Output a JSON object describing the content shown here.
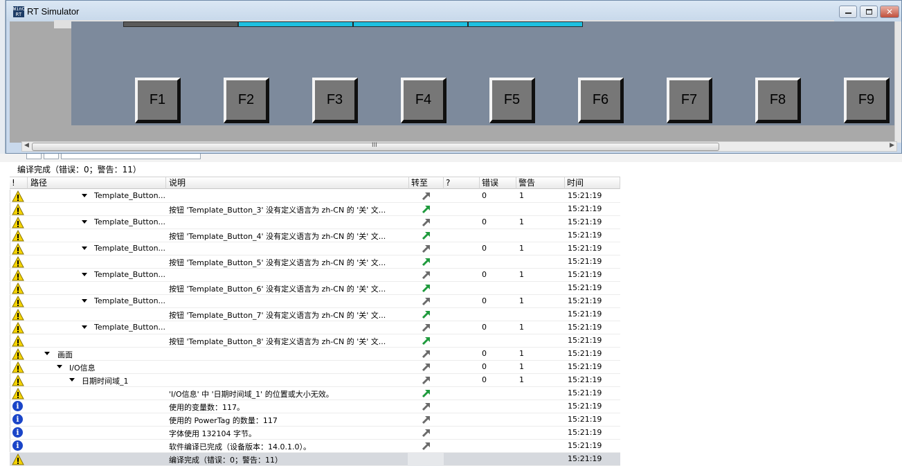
{
  "simulator": {
    "title": "RT Simulator",
    "logo_text": "WinCC RT",
    "top_bar_colors": [
      "#5a5a5a",
      "#1ec0e0",
      "#1ec0e0",
      "#1ec0e0"
    ],
    "function_keys": [
      "F1",
      "F2",
      "F3",
      "F4",
      "F5",
      "F6",
      "F7",
      "F8",
      "F9"
    ],
    "hscroll_grip": "III"
  },
  "output": {
    "summary": "编译完成（错误：0；警告：11）",
    "columns": {
      "flag": "!",
      "path": "路径",
      "description": "说明",
      "goto": "转至",
      "question": "?",
      "errors": "错误",
      "warnings": "警告",
      "time": "时间"
    },
    "rows": [
      {
        "icon": "warning",
        "indent": 1,
        "expand": true,
        "path": "Template_Button...",
        "desc": "",
        "goto": "grey",
        "errors": "0",
        "warnings": "1",
        "time": "15:21:19"
      },
      {
        "icon": "warning",
        "indent": 0,
        "expand": false,
        "path": "",
        "desc": "按钮 'Template_Button_3' 没有定义语言为 zh-CN 的 '关' 文...",
        "goto": "green",
        "errors": "",
        "warnings": "",
        "time": "15:21:19"
      },
      {
        "icon": "warning",
        "indent": 1,
        "expand": true,
        "path": "Template_Button...",
        "desc": "",
        "goto": "grey",
        "errors": "0",
        "warnings": "1",
        "time": "15:21:19"
      },
      {
        "icon": "warning",
        "indent": 0,
        "expand": false,
        "path": "",
        "desc": "按钮 'Template_Button_4' 没有定义语言为 zh-CN 的 '关' 文...",
        "goto": "green",
        "errors": "",
        "warnings": "",
        "time": "15:21:19"
      },
      {
        "icon": "warning",
        "indent": 1,
        "expand": true,
        "path": "Template_Button...",
        "desc": "",
        "goto": "grey",
        "errors": "0",
        "warnings": "1",
        "time": "15:21:19"
      },
      {
        "icon": "warning",
        "indent": 0,
        "expand": false,
        "path": "",
        "desc": "按钮 'Template_Button_5' 没有定义语言为 zh-CN 的 '关' 文...",
        "goto": "green",
        "errors": "",
        "warnings": "",
        "time": "15:21:19"
      },
      {
        "icon": "warning",
        "indent": 1,
        "expand": true,
        "path": "Template_Button...",
        "desc": "",
        "goto": "grey",
        "errors": "0",
        "warnings": "1",
        "time": "15:21:19"
      },
      {
        "icon": "warning",
        "indent": 0,
        "expand": false,
        "path": "",
        "desc": "按钮 'Template_Button_6' 没有定义语言为 zh-CN 的 '关' 文...",
        "goto": "green",
        "errors": "",
        "warnings": "",
        "time": "15:21:19"
      },
      {
        "icon": "warning",
        "indent": 1,
        "expand": true,
        "path": "Template_Button...",
        "desc": "",
        "goto": "grey",
        "errors": "0",
        "warnings": "1",
        "time": "15:21:19"
      },
      {
        "icon": "warning",
        "indent": 0,
        "expand": false,
        "path": "",
        "desc": "按钮 'Template_Button_7' 没有定义语言为 zh-CN 的 '关' 文...",
        "goto": "green",
        "errors": "",
        "warnings": "",
        "time": "15:21:19"
      },
      {
        "icon": "warning",
        "indent": 1,
        "expand": true,
        "path": "Template_Button...",
        "desc": "",
        "goto": "grey",
        "errors": "0",
        "warnings": "1",
        "time": "15:21:19"
      },
      {
        "icon": "warning",
        "indent": 0,
        "expand": false,
        "path": "",
        "desc": "按钮 'Template_Button_8' 没有定义语言为 zh-CN 的 '关' 文...",
        "goto": "green",
        "errors": "",
        "warnings": "",
        "time": "15:21:19"
      },
      {
        "icon": "warning",
        "indent": 2,
        "expand": true,
        "path": "画面",
        "desc": "",
        "goto": "grey",
        "errors": "0",
        "warnings": "1",
        "time": "15:21:19"
      },
      {
        "icon": "warning",
        "indent": 3,
        "expand": true,
        "path": "I/O信息",
        "desc": "",
        "goto": "grey",
        "errors": "0",
        "warnings": "1",
        "time": "15:21:19"
      },
      {
        "icon": "warning",
        "indent": 4,
        "expand": true,
        "path": "日期时间域_1",
        "desc": "",
        "goto": "grey",
        "errors": "0",
        "warnings": "1",
        "time": "15:21:19"
      },
      {
        "icon": "warning",
        "indent": 0,
        "expand": false,
        "path": "",
        "desc": "'I/O信息' 中 '日期时间域_1' 的位置或大小无效。",
        "goto": "green",
        "errors": "",
        "warnings": "",
        "time": "15:21:19"
      },
      {
        "icon": "info",
        "indent": 0,
        "expand": false,
        "path": "",
        "desc": "使用的变量数：117。",
        "goto": "grey",
        "errors": "",
        "warnings": "",
        "time": "15:21:19"
      },
      {
        "icon": "info",
        "indent": 0,
        "expand": false,
        "path": "",
        "desc": "使用的 PowerTag 的数量：117",
        "goto": "grey",
        "errors": "",
        "warnings": "",
        "time": "15:21:19"
      },
      {
        "icon": "info",
        "indent": 0,
        "expand": false,
        "path": "",
        "desc": "字体使用 132104 字节。",
        "goto": "grey",
        "errors": "",
        "warnings": "",
        "time": "15:21:19"
      },
      {
        "icon": "info",
        "indent": 0,
        "expand": false,
        "path": "",
        "desc": "软件编译已完成（设备版本：14.0.1.0）。",
        "goto": "grey",
        "errors": "",
        "warnings": "",
        "time": "15:21:19"
      },
      {
        "icon": "warning",
        "indent": 0,
        "expand": false,
        "path": "",
        "desc": "编译完成（错误：0；警告：11）",
        "goto": "none",
        "errors": "",
        "warnings": "",
        "time": "15:21:19",
        "selected": true
      }
    ]
  },
  "colors": {
    "goto_green": "#1e9a3c",
    "goto_grey": "#6a6a6a",
    "warning_yellow": "#f5d400",
    "info_blue": "#1a45c8"
  }
}
